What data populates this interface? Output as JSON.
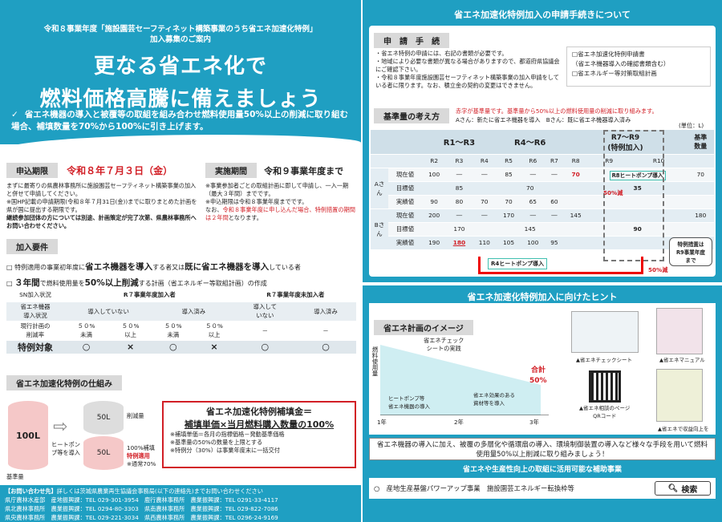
{
  "hero": {
    "line1": "令和８事業年度「施設園芸セーフティネット構築事業のうち省エネ加速化特例」",
    "line2": "加入募集のご案内",
    "title1": "更なる省エネ化で",
    "title2": "燃料価格高騰に備えましょう",
    "check": "✓",
    "note": "省エネ機器の導入と被覆等の取組を組み合わせ燃料使用量50%以上の削減に取り組む場合、補填数量を70%から100%に引き上げます。"
  },
  "apply": {
    "label": "申込期限",
    "deadline": "令和８年７月３日（金）",
    "body1": "まずに最寄りの県農林事務所に施設園芸セーフティネット構築事業の加入と併せて申請してください。",
    "body2": "※国HP記載の申請期限(令和８年７月31日(金))までに取りまとめた計画を県が国に提出する期限です。",
    "body3": "継続参加団体の方については別途、計画策定が完了次第、県農林事務所へお問い合わせください。"
  },
  "period": {
    "label": "実施期間",
    "value": "令和９事業年度まで",
    "body1": "※事業参加者ごとの取組計画に即して申請し、一入一期（最大３年間）までです。",
    "body2": "※申込期限は令和８事業年度までです。",
    "body3a": "なお、",
    "body3b": "令和８事業年度に申し込んだ場合、特例措置の期間は２年間",
    "body3c": "となります。"
  },
  "req": {
    "label": "加入要件",
    "item1a": "特例適用の事業初年度に",
    "item1b": "省エネ機器を導入",
    "item1c": "する者又は",
    "item1d": "既に省エネ機器を導入",
    "item1e": "している者",
    "item2a": "３年間",
    "item2b": "で燃料使用量を",
    "item2c": "50%以上削減",
    "item2d": "する計画（省エネルギー等取組計画）の作成",
    "box": "□"
  },
  "table": {
    "h0": "SN加入状況",
    "h1": "R７事業年度加入者",
    "h2": "R７事業年度未加入者",
    "r1": [
      "省エネ機器\n導入状況",
      "導入していない",
      "導入済み",
      "導入して\nいない",
      "導入済み"
    ],
    "r2": [
      "現行計画の\n削減率",
      "５０%\n未満",
      "５０%\n以上",
      "５０%\n未満",
      "５０%\n以上",
      "－",
      "－"
    ],
    "r3": [
      "特例対象",
      "○",
      "×",
      "○",
      "×",
      "○",
      "○"
    ]
  },
  "mech": {
    "label": "省エネ加速化特例の仕組み",
    "c1": "100L",
    "c2top": "50L",
    "c2bot": "50L",
    "arrow": "⇨",
    "heat": "ヒートポン\nプ等を導入",
    "cut": "削減量",
    "fill": "100%補填",
    "fill2": "特例適用",
    "normal": "※通常70%",
    "base": "基準量",
    "formula1": "省エネ加速化特例補填金＝",
    "formula2": "補填単価×当月燃料購入数量の100%",
    "n1": "※補填単価＝各月の指標価格－発動基準価格",
    "n2": "※基準量の50%の数量を上限とする",
    "n3": "※特例分（30%）は事業年度末に一括交付"
  },
  "contact": {
    "title": "【お問い合わせ先】",
    "title2": "詳しくは茨城県農業再生協議会事務局(以下の連絡先)までお問い合わせください",
    "rows": [
      "県庁農林水産部　産地振興課：TEL 029-301-3954　鹿行農林事務所　農業振興課：TEL 0291-33-4117",
      "県北農林事務所　農業振興課：TEL 0294-80-3303　県南農林事務所　農業振興課：TEL 029-822-7086",
      "県央農林事務所　農業振興課：TEL 029-221-3034　県西農林事務所　農業振興課：TEL 0296-24-9169"
    ]
  },
  "proc": {
    "title": "省エネ加速化特例加入の申請手続きについて",
    "label": "申　請　手　続",
    "t1": "・令和８事業年度施設園芸セーフティネット構築事業の加入申請書等（省エネ加速化特例）",
    "t_body": "・省エネ特例の申請には、右記の書類が必要です。\n・地域により必要な書類が異なる場合がありますので、都道府県協議会にご確認下さい。\n・令和８事業年度施設園芸セーフティネット構築事業の加入申請をしている者に限ります。なお、積立金の契約の変更はできません。",
    "docs1": "□省エネ加速化特例申請書",
    "docs2": "（省エネ機器導入の確認書類含む）",
    "docs3": "□省エネルギー等対策取組計画"
  },
  "base": {
    "label": "基準量の考え方",
    "red": "赤字が基準量です。基準量から50%以上の燃料使用量の削減に取り組みます。",
    "ab": "Aさん：新たに省エネ機器を導入　Bさん：既に省エネ機器導入済み",
    "unit": "(単位：L)",
    "g1": "R1〜R3",
    "g2": "R4〜R6",
    "g3": "R7〜R9\n(特例加入)",
    "g4": "基準\n数量",
    "years": [
      "R2",
      "R3",
      "R4",
      "R5",
      "R6",
      "R7",
      "R8",
      "R9",
      "R10"
    ],
    "rowA": "Aさん",
    "rowB": "Bさん",
    "r_now": "現在値",
    "r_goal": "目標値",
    "r_act": "実績値",
    "a_now": [
      "100",
      "―",
      "―",
      "85",
      "―",
      "―",
      "70",
      "",
      "",
      "70"
    ],
    "a_goal_1": "85",
    "a_goal_2": "70",
    "a_goal_3": "35",
    "a_act": [
      "90",
      "80",
      "70",
      "70",
      "65",
      "60"
    ],
    "b_now": [
      "200",
      "―",
      "―",
      "170",
      "―",
      "―",
      "145",
      "",
      "",
      "180"
    ],
    "b_goal_1": "170",
    "b_goal_2": "145",
    "b_goal_3": "90",
    "b_act": [
      "190",
      "180",
      "110",
      "105",
      "100",
      "95"
    ],
    "a_hp": "R8ヒートポンプ導入",
    "b_hp": "R4ヒートポンプ導入",
    "cut50a": "50%減",
    "cut50b": "50%減",
    "special": "特例措置は\nR9事業年度\nまで"
  },
  "hint": {
    "title": "省エネ加速化特例加入に向けたヒント",
    "img_label": "省エネ計画のイメージ",
    "ylab": "燃料使用量",
    "cap1": "省エネチェック\nシートの実践",
    "cap2": "ヒートポンプ等\n省エネ機器の導入",
    "cap3": "省エネ効果のある\n資材等を導入",
    "sum": "合計",
    "sum2": "50%",
    "x1": "1年",
    "x2": "2年",
    "x3": "3年",
    "link1": "▲省エネチェックシート",
    "link2": "▲省エネマニュアル",
    "link3": "▲省エネ相談のページ\nQRコード",
    "link4": "▲省エネで収益向上を",
    "msg": "省エネ機器の導入に加え、被覆の多層化や循環扇の導入、環境制御装置の導入など様々な手段を用いて燃料使用量50%以上削減に取り組みましょう！",
    "sub": "省エネや生産性向上の取組に活用可能な補助事業",
    "item": "○　産地生産基盤パワーアップ事業　施設園芸エネルギー転換枠等",
    "search": "検索"
  }
}
